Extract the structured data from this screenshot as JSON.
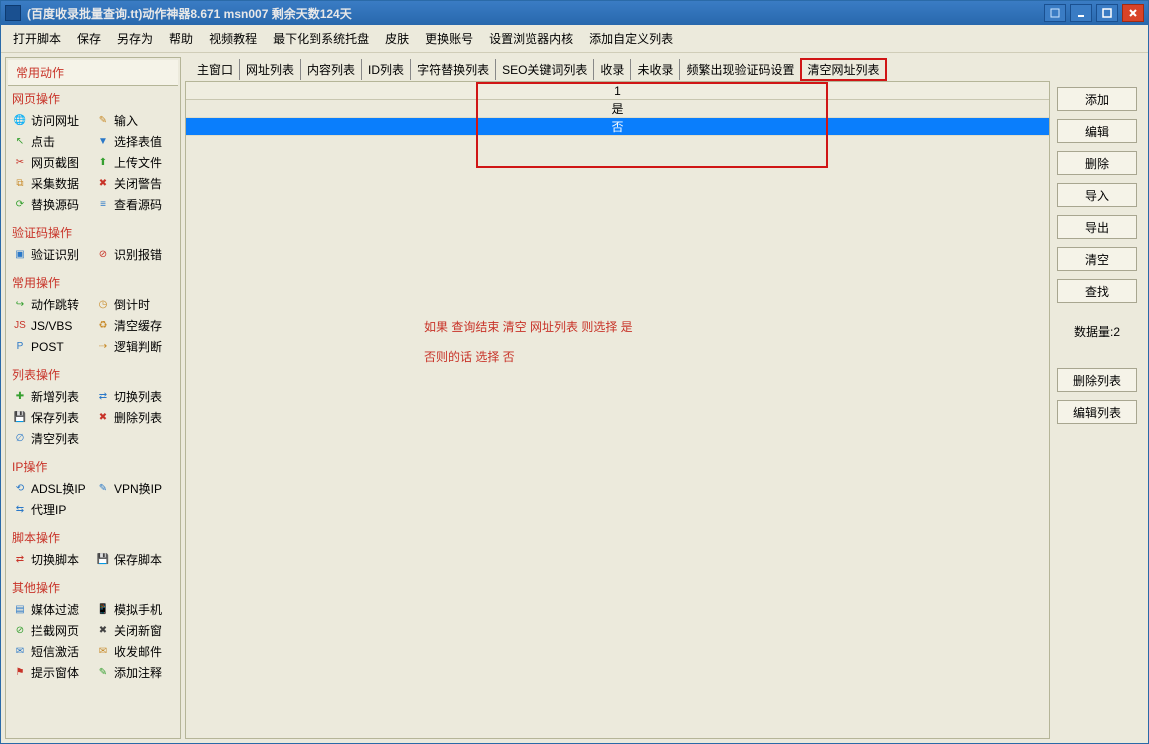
{
  "title": "(百度收录批量查询.tt)动作神器8.671 msn007 剩余天数124天",
  "menubar": [
    "打开脚本",
    "保存",
    "另存为",
    "帮助",
    "视频教程",
    "最下化到系统托盘",
    "皮肤",
    "更换账号",
    "设置浏览器内核",
    "添加自定义列表"
  ],
  "sidebar_tab": "常用动作",
  "sections": [
    {
      "title": "网页操作",
      "items": [
        {
          "icon": "globe-icon",
          "label": "访问网址"
        },
        {
          "icon": "pen-icon",
          "label": "输入"
        },
        {
          "icon": "click-icon",
          "label": "点击"
        },
        {
          "icon": "select-icon",
          "label": "选择表值"
        },
        {
          "icon": "scissors-icon",
          "label": "网页截图"
        },
        {
          "icon": "upload-icon",
          "label": "上传文件"
        },
        {
          "icon": "gather-icon",
          "label": "采集数据"
        },
        {
          "icon": "warn-icon",
          "label": "关闭警告"
        },
        {
          "icon": "code-icon",
          "label": "替换源码"
        },
        {
          "icon": "html-icon",
          "label": "查看源码"
        }
      ]
    },
    {
      "title": "验证码操作",
      "items": [
        {
          "icon": "captcha-icon",
          "label": "验证识别"
        },
        {
          "icon": "error-icon",
          "label": "识别报错"
        }
      ]
    },
    {
      "title": "常用操作",
      "items": [
        {
          "icon": "jump-icon",
          "label": "动作跳转"
        },
        {
          "icon": "clock-icon",
          "label": "倒计时"
        },
        {
          "icon": "js-icon",
          "label": "JS/VBS"
        },
        {
          "icon": "cache-icon",
          "label": "清空缓存"
        },
        {
          "icon": "post-icon",
          "label": "POST"
        },
        {
          "icon": "logic-icon",
          "label": "逻辑判断"
        }
      ]
    },
    {
      "title": "列表操作",
      "items": [
        {
          "icon": "new-list-icon",
          "label": "新增列表"
        },
        {
          "icon": "switch-list-icon",
          "label": "切换列表"
        },
        {
          "icon": "save-list-icon",
          "label": "保存列表"
        },
        {
          "icon": "delete-list-icon",
          "label": "删除列表"
        },
        {
          "icon": "clear-list-icon",
          "label": "清空列表"
        }
      ]
    },
    {
      "title": "IP操作",
      "items": [
        {
          "icon": "adsl-icon",
          "label": "ADSL换IP"
        },
        {
          "icon": "vpn-icon",
          "label": "VPN换IP"
        },
        {
          "icon": "proxy-icon",
          "label": "代理IP"
        }
      ]
    },
    {
      "title": "脚本操作",
      "items": [
        {
          "icon": "switch-script-icon",
          "label": "切换脚本"
        },
        {
          "icon": "save-script-icon",
          "label": "保存脚本"
        }
      ]
    },
    {
      "title": "其他操作",
      "items": [
        {
          "icon": "media-icon",
          "label": "媒体过滤"
        },
        {
          "icon": "phone-icon",
          "label": "模拟手机"
        },
        {
          "icon": "block-icon",
          "label": "拦截网页"
        },
        {
          "icon": "close-window-icon",
          "label": "关闭新窗"
        },
        {
          "icon": "sms-icon",
          "label": "短信激活"
        },
        {
          "icon": "mail-icon",
          "label": "收发邮件"
        },
        {
          "icon": "alert-icon",
          "label": "提示窗体"
        },
        {
          "icon": "note-icon",
          "label": "添加注释"
        }
      ]
    }
  ],
  "tabs": [
    "主窗口",
    "网址列表",
    "内容列表",
    "ID列表",
    "字符替换列表",
    "SEO关键词列表",
    "收录",
    "未收录",
    "频繁出现验证码设置",
    "清空网址列表"
  ],
  "tab_highlight_index": 9,
  "table": {
    "header": "1",
    "rows": [
      "是",
      "否"
    ],
    "selected_index": 1
  },
  "help_text_line1": "如果 查询结束 清空 网址列表 则选择  是",
  "help_text_line2": "否则的话 选择 否",
  "right_buttons": [
    "添加",
    "编辑",
    "删除",
    "导入",
    "导出",
    "清空",
    "查找"
  ],
  "data_count_label": "数据量:2",
  "right_buttons2": [
    "删除列表",
    "编辑列表"
  ]
}
